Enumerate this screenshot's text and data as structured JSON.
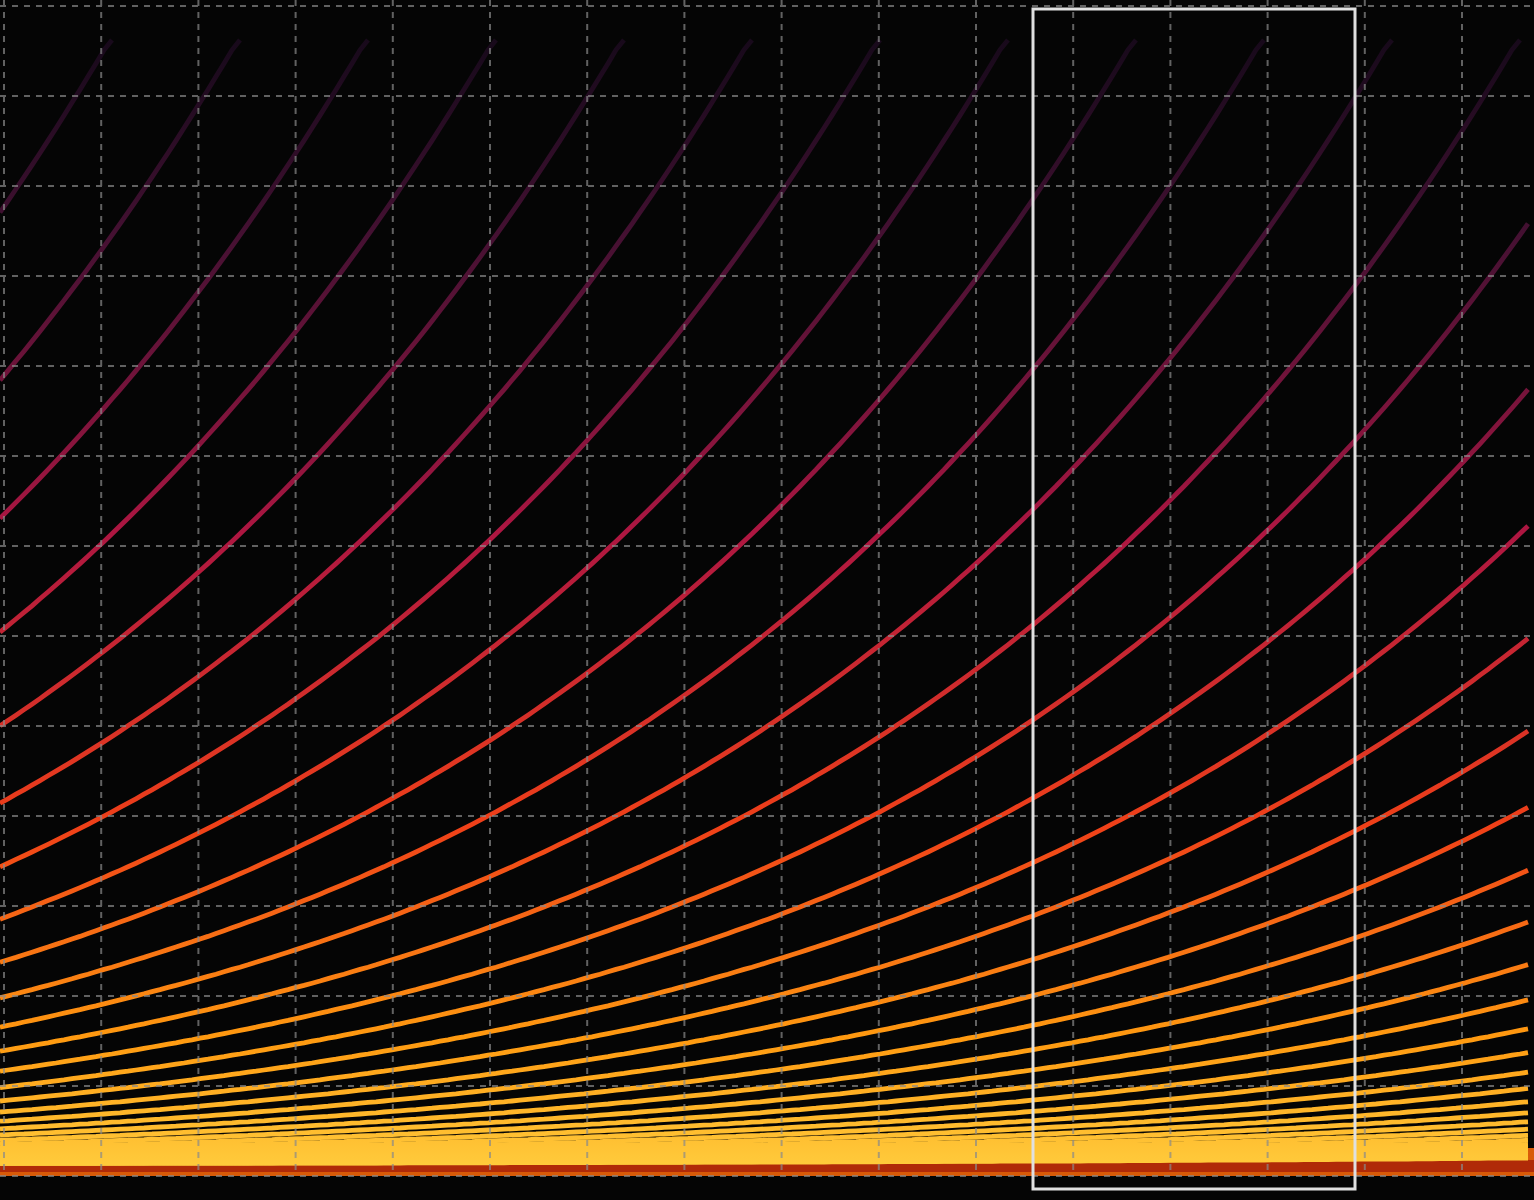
{
  "spectrogram": {
    "kind": "spectrogram",
    "selection_visible": true
  }
}
